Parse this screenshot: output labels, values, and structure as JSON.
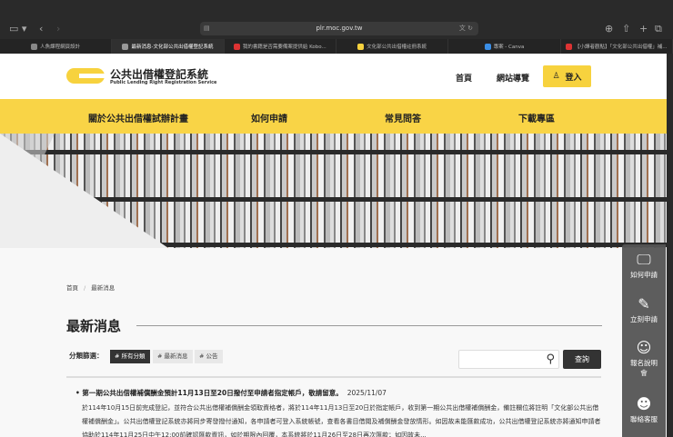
{
  "browser": {
    "url": "plr.moc.gov.tw",
    "tabs": [
      {
        "label": "人魚課程網頁設計",
        "color": "#888"
      },
      {
        "label": "最新消息-文化部公共出借權登記系統",
        "color": "#999",
        "active": true
      },
      {
        "label": "我的書籍是否需要備案提供給 Kobo...",
        "color": "#d33"
      },
      {
        "label": "文化部公共出借權註冊系統",
        "color": "#f7d23e"
      },
      {
        "label": "專案 - Canva",
        "color": "#3a8ee6"
      },
      {
        "label": "【小譯者觀點】「文化部公共出借權」補...",
        "color": "#d33"
      }
    ]
  },
  "header": {
    "site_title": "公共出借權登記系統",
    "site_subtitle": "Public Lending Right Registration Service",
    "home": "首頁",
    "sitemap": "網站導覽",
    "login": "登入"
  },
  "nav": [
    "關於公共出借權試辦計畫",
    "如何申請",
    "常見問答",
    "下載專區"
  ],
  "breadcrumb": [
    "首頁",
    "最新消息"
  ],
  "page_title": "最新消息",
  "filter": {
    "label": "分類篩選：",
    "chips": [
      "# 所有分類",
      "# 最新消息",
      "# 公告"
    ],
    "search_placeholder": "",
    "search_button": "查詢"
  },
  "news": [
    {
      "title": "第一期公共出借權補償酬金預計11月13日至20日撥付至申請者指定帳戶，敬請留意。",
      "date": "2025/11/07",
      "body": "於114年10月15日前完成登記，並符合公共出借權補償酬金領取資格者，將於114年11月13日至20日於指定帳戶，收到第一期公共出借權補償酬金，備註欄位將註明「文化部公共出借權補償酬金」。公共出借權登記系統亦將同步寄發撥付通知，各申請者可登入系統帳號，查看各書目借閱及補償酬金發放情形。如因故未能匯款成功，公共出借權登記系統亦將通知申請者協助於114年11月25日中午12:00前確認匯款資訊，如於期限內回覆，本系統將於11月26日至28日再次匯款；如因故未..."
    }
  ],
  "side_menu": [
    "如何申請",
    "立刻申請",
    "報名說明會",
    "聯絡客服"
  ]
}
